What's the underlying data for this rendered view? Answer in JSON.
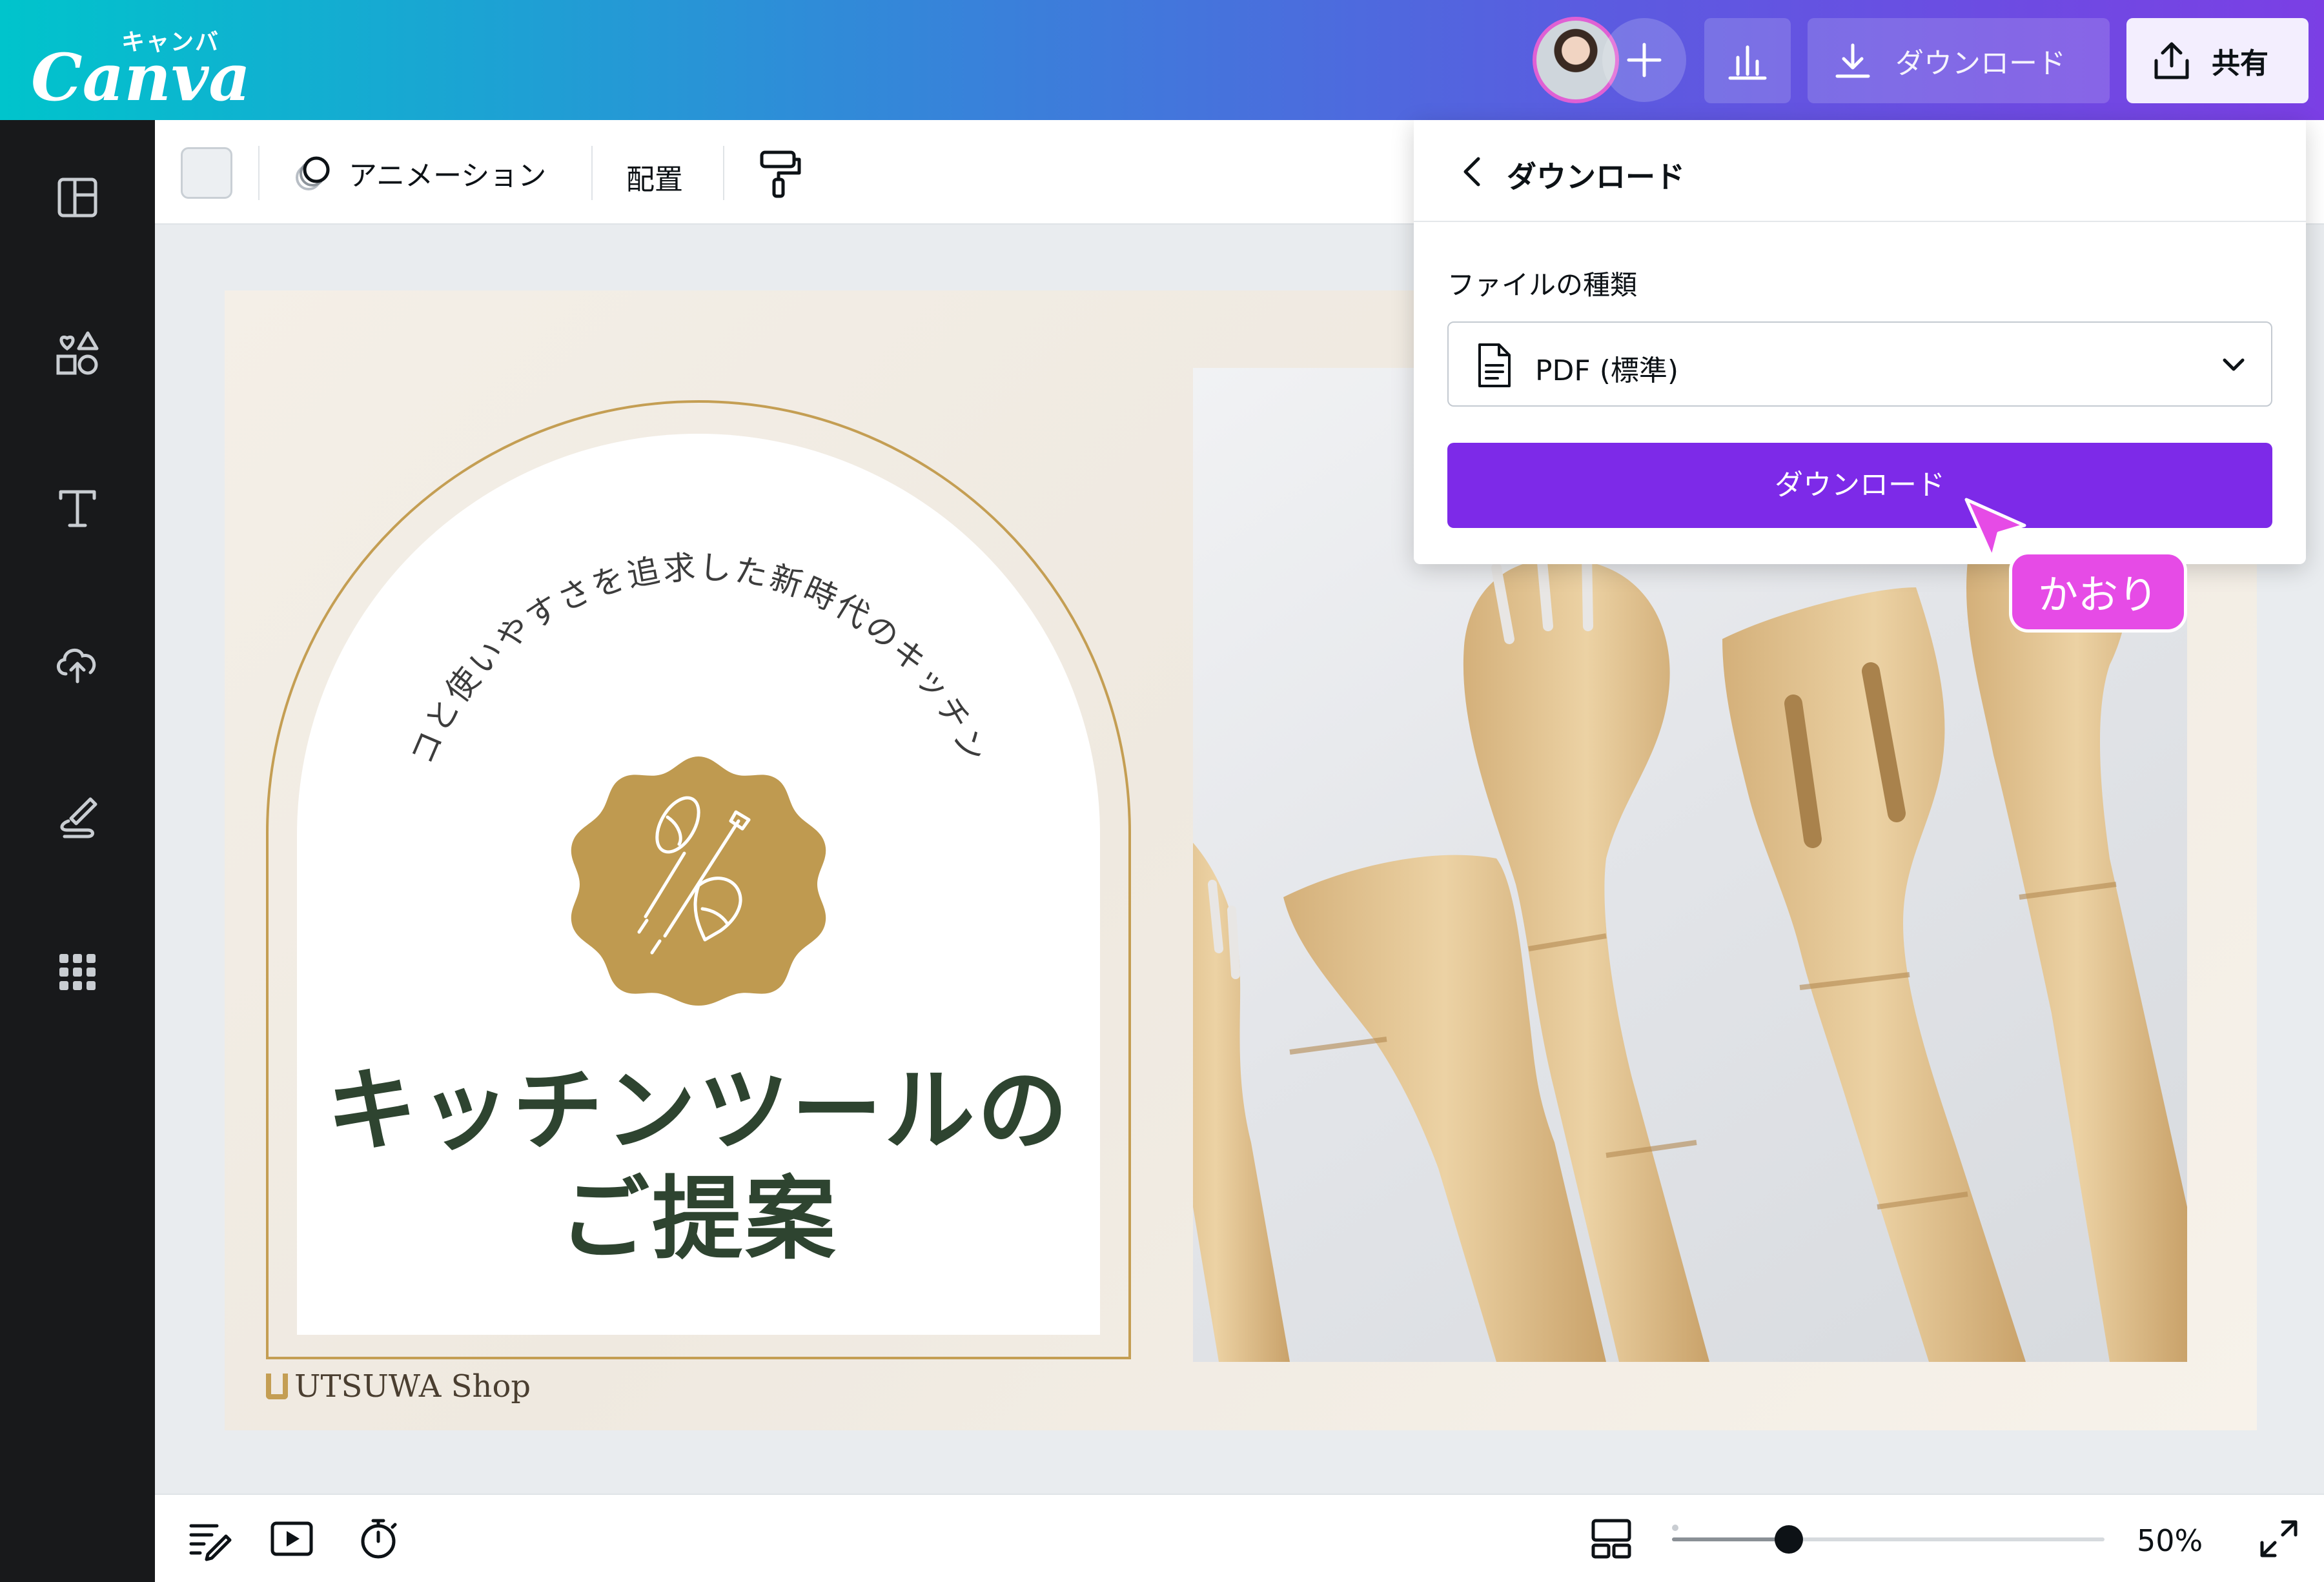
{
  "app": {
    "logo_kana": "キャンバ",
    "logo_word": "Canva"
  },
  "topbar": {
    "download_label": "ダウンロード",
    "share_label": "共有"
  },
  "context_toolbar": {
    "animation_label": "アニメーション",
    "arrange_label": "配置"
  },
  "design": {
    "curved_text": "エコと使いやすさを追求した新時代のキッチンへ",
    "title_line1": "キッチンツールの",
    "title_line2": "ご提案",
    "shop_name": "UTSUWA Shop"
  },
  "download_panel": {
    "title": "ダウンロード",
    "file_type_label": "ファイルの種類",
    "file_type_value": "PDF (標準)",
    "download_button": "ダウンロード"
  },
  "collaborator": {
    "name": "かおり"
  },
  "bottombar": {
    "zoom_value": "50%",
    "zoom_level": 0.5
  },
  "colors": {
    "accent_purple": "#7d2ae8",
    "collaborator_pink": "#e64be6",
    "title_green": "#2e4430",
    "gold": "#c49e53"
  }
}
